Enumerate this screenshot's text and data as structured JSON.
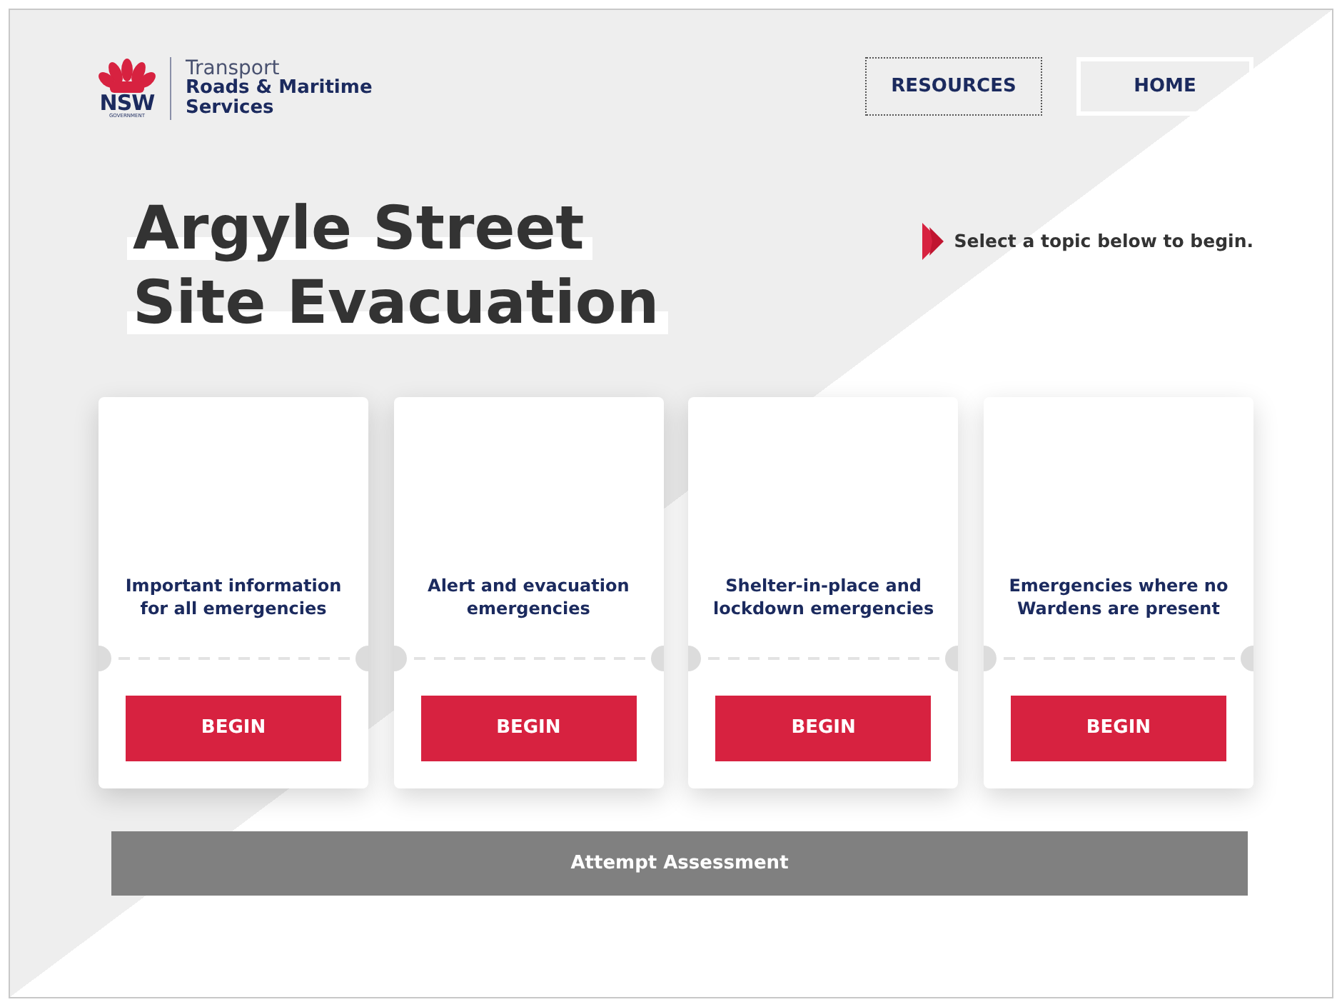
{
  "logo": {
    "mark": "NSW",
    "mark_sub": "GOVERNMENT",
    "agency": "Transport",
    "division_lines": [
      "Roads & Maritime",
      "Services"
    ]
  },
  "nav_buttons": [
    {
      "label": "RESOURCES",
      "selected": true
    },
    {
      "label": "HOME",
      "selected": false
    }
  ],
  "title_lines": [
    "Argyle Street",
    "Site Evacuation"
  ],
  "hint": "Select a topic below to begin.",
  "topics": [
    {
      "label": "Important information for all emergencies",
      "button": "BEGIN"
    },
    {
      "label": "Alert and evacuation emergencies",
      "button": "BEGIN"
    },
    {
      "label": "Shelter-in-place and lockdown emergencies",
      "button": "BEGIN"
    },
    {
      "label": "Emergencies where no Wardens are present",
      "button": "BEGIN"
    }
  ],
  "assessment_button": "Attempt Assessment"
}
